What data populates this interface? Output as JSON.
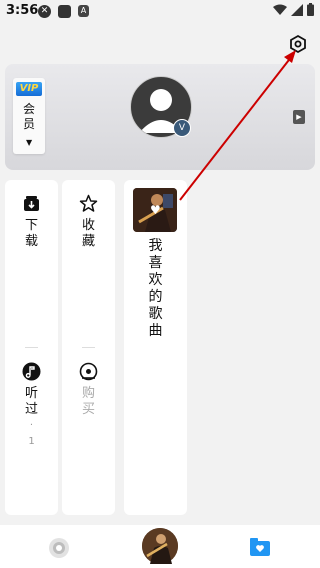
{
  "status_bar": {
    "time": "3:56"
  },
  "profile": {
    "vip_badge": "VIP",
    "vip_label": "会员"
  },
  "tiles": {
    "download": {
      "label": "下载"
    },
    "favorite": {
      "label": "收藏"
    },
    "my_favorite_songs": {
      "label": "我喜欢的歌曲"
    },
    "listened": {
      "label": "听过",
      "count": "· 1"
    },
    "purchased": {
      "label": "购买"
    }
  },
  "colors": {
    "accent_blue": "#2196f3",
    "annotation_red": "#cc0000"
  }
}
